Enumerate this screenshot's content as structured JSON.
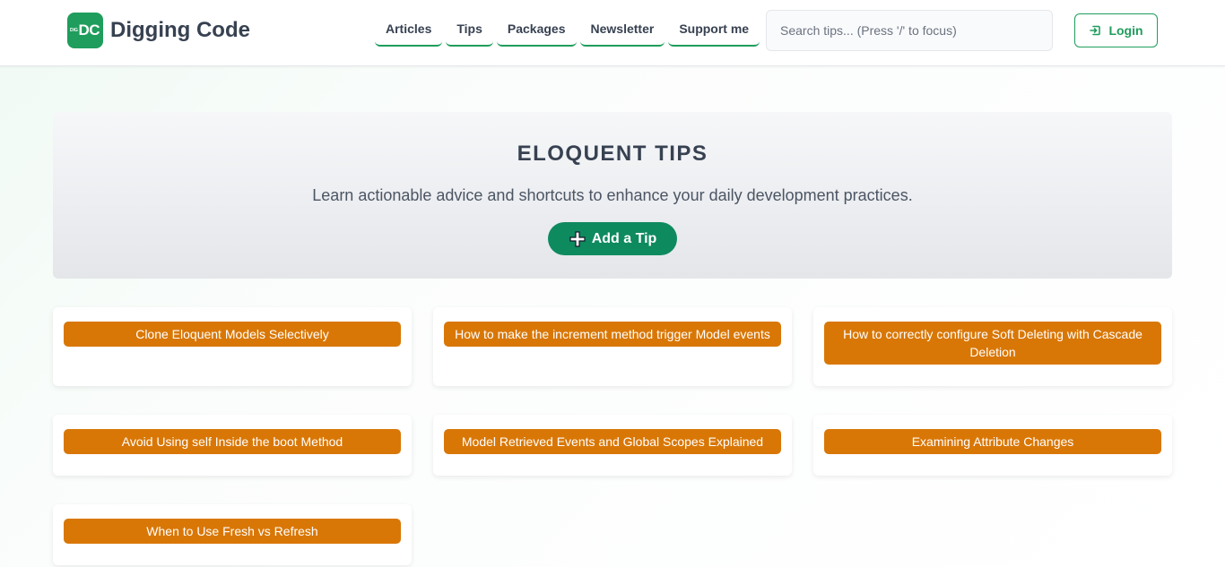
{
  "header": {
    "logo_mark": "DC",
    "logo_mark_small": "DIG",
    "brand": "Digging Code",
    "nav": [
      {
        "label": "Articles"
      },
      {
        "label": "Tips"
      },
      {
        "label": "Packages"
      },
      {
        "label": "Newsletter"
      },
      {
        "label": "Support me"
      }
    ],
    "search_placeholder": "Search tips... (Press '/' to focus)",
    "login_label": "Login",
    "login_icon": "login-icon"
  },
  "hero": {
    "title": "ELOQUENT TIPS",
    "subtitle": "Learn actionable advice and shortcuts to enhance your daily development practices.",
    "add_label": "Add a Tip",
    "add_icon": "plus-icon"
  },
  "tips": [
    {
      "title": "Clone Eloquent Models Selectively"
    },
    {
      "title": "How to make the increment method trigger Model events"
    },
    {
      "title": "How to correctly configure Soft Deleting with Cascade Deletion"
    },
    {
      "title": "Avoid Using self Inside the boot Method"
    },
    {
      "title": "Model Retrieved Events and Global Scopes Explained"
    },
    {
      "title": "Examining Attribute Changes"
    },
    {
      "title": "When to Use Fresh vs Refresh"
    }
  ],
  "colors": {
    "brand_green": "#1f9d5c",
    "button_green": "#0e8a5f",
    "tip_orange": "#d97706"
  }
}
